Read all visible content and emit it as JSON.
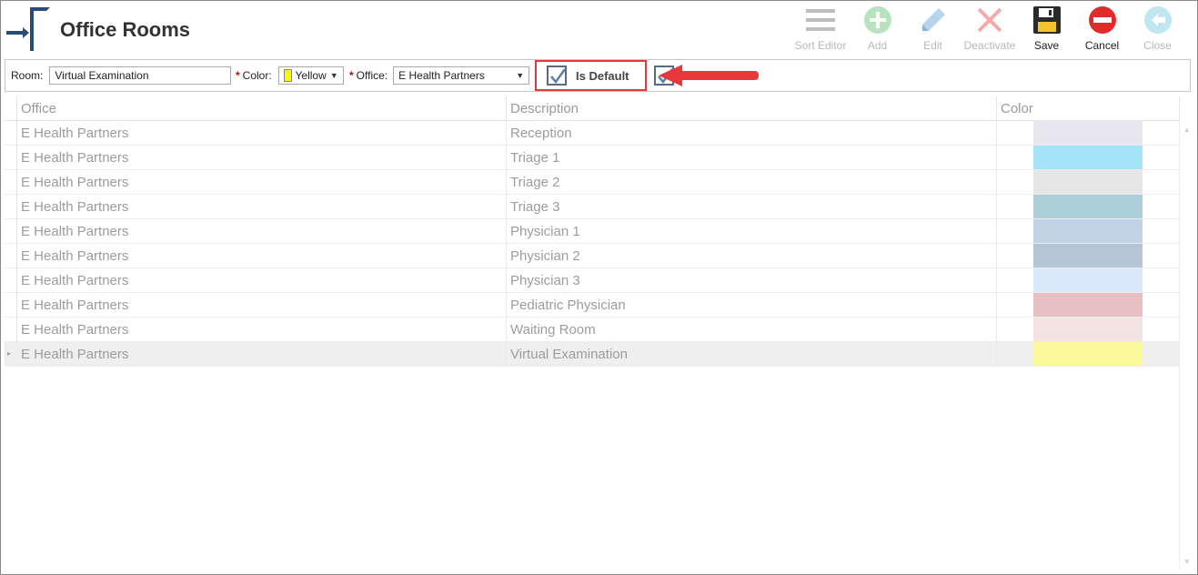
{
  "header": {
    "title": "Office Rooms"
  },
  "toolbar": {
    "sort_editor": "Sort Editor",
    "add": "Add",
    "edit": "Edit",
    "deactivate": "Deactivate",
    "save": "Save",
    "cancel": "Cancel",
    "close": "Close"
  },
  "form": {
    "room_label": "Room:",
    "room_value": "Virtual Examination",
    "color_label": "Color:",
    "color_value": "Yellow",
    "color_hex": "#f8f800",
    "office_label": "Office:",
    "office_value": "E Health Partners",
    "is_default_label": "Is Default",
    "is_default_checked": true,
    "virtual_checked": true
  },
  "grid": {
    "columns": [
      "Office",
      "Description",
      "Color"
    ],
    "rows": [
      {
        "office": "E Health Partners",
        "description": "Reception",
        "color": "#e8e6ef"
      },
      {
        "office": "E Health Partners",
        "description": "Triage 1",
        "color": "#a3e4f8"
      },
      {
        "office": "E Health Partners",
        "description": "Triage 2",
        "color": "#e6e6e6"
      },
      {
        "office": "E Health Partners",
        "description": "Triage 3",
        "color": "#abd0d7"
      },
      {
        "office": "E Health Partners",
        "description": "Physician 1",
        "color": "#c2d2e6"
      },
      {
        "office": "E Health Partners",
        "description": "Physician 2",
        "color": "#b6c5d5"
      },
      {
        "office": "E Health Partners",
        "description": "Physician 3",
        "color": "#d9e9fb"
      },
      {
        "office": "E Health Partners",
        "description": "Pediatric Physician",
        "color": "#e8c0c1"
      },
      {
        "office": "E Health Partners",
        "description": "Waiting Room",
        "color": "#f3e3e3"
      },
      {
        "office": "E Health Partners",
        "description": "Virtual Examination",
        "color": "#fbfa9a"
      }
    ],
    "selected_row": 9
  }
}
